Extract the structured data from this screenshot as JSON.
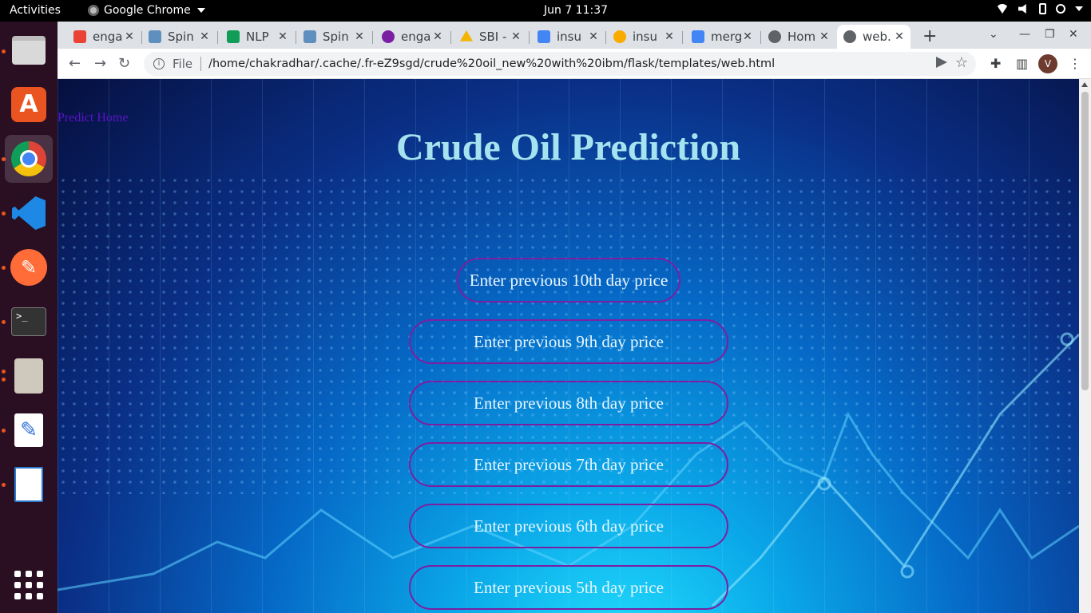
{
  "topbar": {
    "activities": "Activities",
    "app_name": "Google Chrome",
    "clock": "Jun 7  11:37"
  },
  "tabs": [
    {
      "title": "enga",
      "favicon": "gmail-icon",
      "color": "#ea4335"
    },
    {
      "title": "Spin",
      "favicon": "image-icon",
      "color": "#5f8fbf"
    },
    {
      "title": "NLP",
      "favicon": "sheets-icon",
      "color": "#0f9d58"
    },
    {
      "title": "Spin",
      "favicon": "image-icon",
      "color": "#5f8fbf"
    },
    {
      "title": "enga",
      "favicon": "lock-icon",
      "color": "#7b1fa2"
    },
    {
      "title": "SBI -",
      "favicon": "drive-icon",
      "color": "#f4b400"
    },
    {
      "title": "insu",
      "favicon": "docs-icon",
      "color": "#4285f4"
    },
    {
      "title": "insu",
      "favicon": "colab-icon",
      "color": "#f9ab00"
    },
    {
      "title": "merg",
      "favicon": "docs-icon",
      "color": "#4285f4"
    },
    {
      "title": "Hom",
      "favicon": "globe-icon",
      "color": "#5f6368"
    },
    {
      "title": "web.",
      "favicon": "globe-icon",
      "color": "#5f6368"
    }
  ],
  "omnibox": {
    "scheme": "File",
    "url": "/home/chakradhar/.cache/.fr-eZ9sgd/crude%20oil_new%20with%20ibm/flask/templates/web.html"
  },
  "profile": {
    "initial": "V"
  },
  "page": {
    "nav_link": "Predict Home",
    "title": "Crude Oil Prediction",
    "fields": [
      {
        "placeholder": "Enter previous 10th day price"
      },
      {
        "placeholder": "Enter previous 9th day price"
      },
      {
        "placeholder": "Enter previous 8th day price"
      },
      {
        "placeholder": "Enter previous 7th day price"
      },
      {
        "placeholder": "Enter previous 6th day price"
      },
      {
        "placeholder": "Enter previous 5th day price"
      }
    ]
  },
  "colors": {
    "title": "#a6e3f0",
    "field_border": "#7b1fa2",
    "link": "#5b13c8",
    "dock": "#2a0f23"
  }
}
